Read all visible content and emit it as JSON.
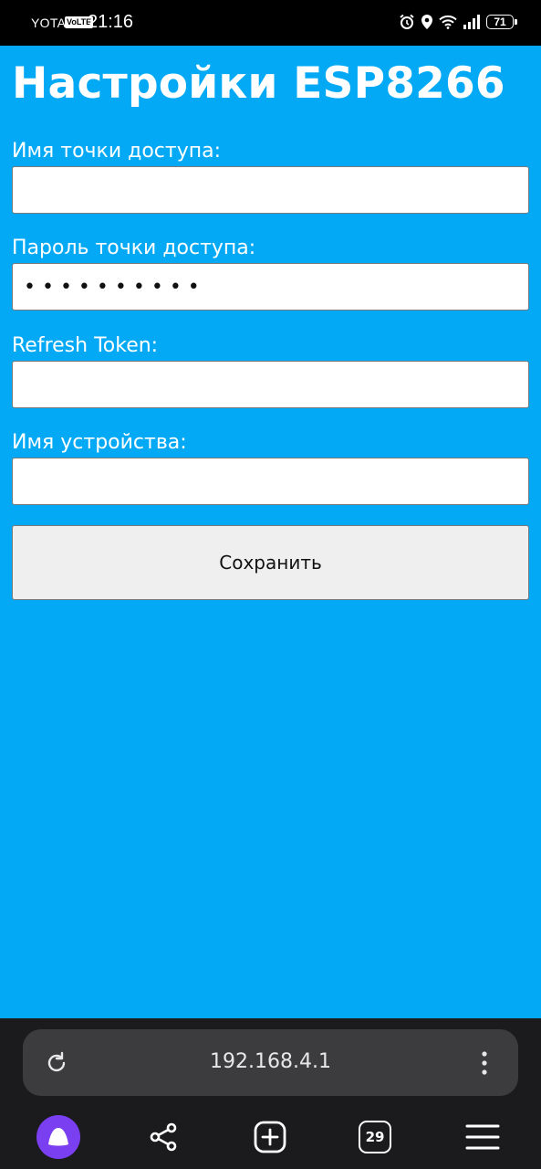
{
  "status_bar": {
    "carrier": "YOTA",
    "volte": "VoLTE",
    "time": "21:16",
    "battery": "71",
    "icons": [
      "alarm-icon",
      "location-icon",
      "wifi-icon",
      "signal-icon",
      "battery-icon"
    ]
  },
  "page": {
    "title": "Настройки ESP8266"
  },
  "form": {
    "ssid": {
      "label": "Имя точки доступа:",
      "value": ""
    },
    "password": {
      "label": "Пароль точки доступа:",
      "value": "••••••••••"
    },
    "token": {
      "label": "Refresh Token:",
      "value": ""
    },
    "device": {
      "label": "Имя устройства:",
      "value": ""
    },
    "save_label": "Сохранить"
  },
  "browser": {
    "url": "192.168.4.1",
    "tabs_count": "29",
    "nav_icons": [
      "alice-icon",
      "share-icon",
      "new-tab-icon",
      "tabs-icon",
      "menu-icon"
    ],
    "colors": {
      "page_bg": "#03a9f4",
      "bar_bg": "#1b1b1d",
      "pill_bg": "#3c3c3f",
      "accent": "#7b3ff2"
    }
  }
}
